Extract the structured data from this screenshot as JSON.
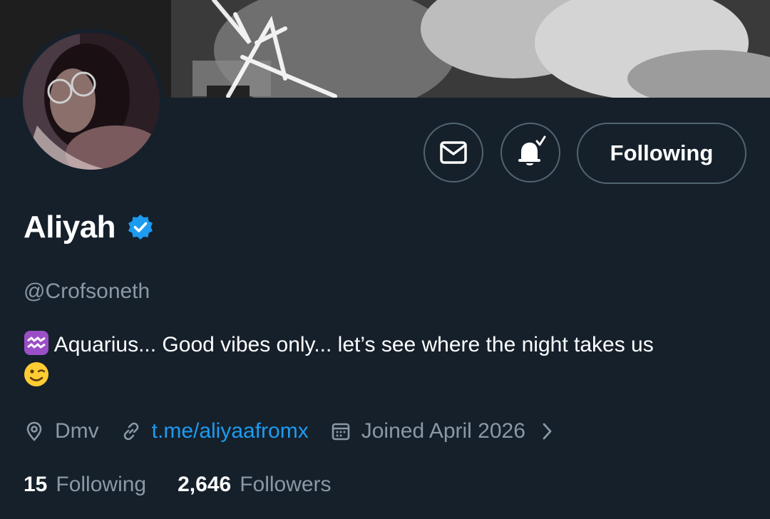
{
  "profile": {
    "display_name": "Aliyah",
    "handle": "@Crofsoneth",
    "bio_text": "Aquarius... Good vibes only... let’s see where the night takes us",
    "location": "Dmv",
    "link": "t.me/aliyaafromx",
    "joined": "Joined April 2026"
  },
  "actions": {
    "follow_label": "Following",
    "message_icon": "mail-icon",
    "notify_icon": "bell-check-icon"
  },
  "stats": {
    "following_count": "15",
    "following_label": "Following",
    "followers_count": "2,646",
    "followers_label": "Followers"
  },
  "colors": {
    "background": "#15202b",
    "muted_text": "#8b98a5",
    "border": "#536471",
    "accent": "#1d9bf0",
    "verified": "#1d9bf0"
  }
}
